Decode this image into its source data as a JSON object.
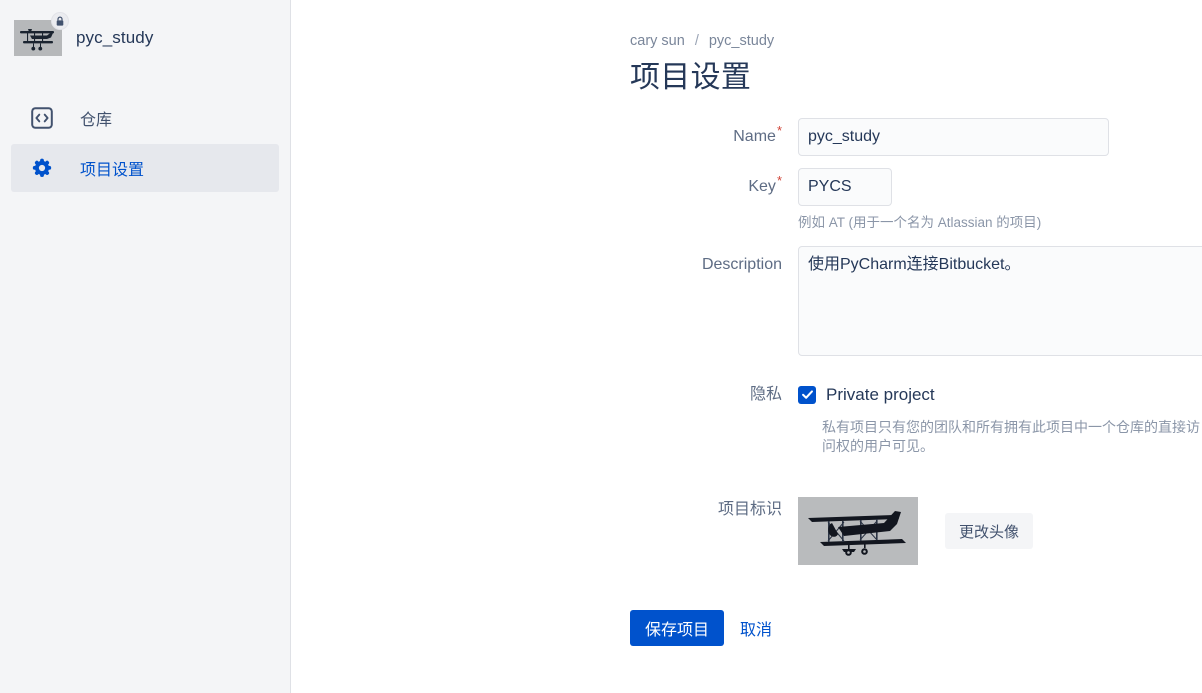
{
  "sidebar": {
    "project_name": "pyc_study",
    "logo_icon": "biplane-logo",
    "lock_badge_icon": "lock-icon",
    "items": [
      {
        "label": "仓库",
        "icon": "code-brackets-icon",
        "active": false
      },
      {
        "label": "项目设置",
        "icon": "gear-icon",
        "active": true
      }
    ]
  },
  "breadcrumb": {
    "owner": "cary sun",
    "separator": "/",
    "project": "pyc_study"
  },
  "page": {
    "title": "项目设置"
  },
  "form": {
    "name": {
      "label": "Name",
      "required_mark": "*",
      "value": "pyc_study",
      "placeholder": ""
    },
    "key": {
      "label": "Key",
      "required_mark": "*",
      "value": "PYCS",
      "placeholder": "",
      "hint": "例如 AT (用于一个名为 Atlassian 的项目)"
    },
    "description": {
      "label": "Description",
      "value": "使用PyCharm连接Bitbucket。",
      "placeholder": ""
    },
    "privacy": {
      "label": "隐私",
      "checkbox_label": "Private project",
      "checked": true,
      "hint": "私有项目只有您的团队和所有拥有此项目中一个仓库的直接访问权的用户可见。"
    },
    "logo": {
      "label": "项目标识",
      "image_icon": "biplane-avatar",
      "change_button": "更改头像"
    }
  },
  "actions": {
    "save_label": "保存项目",
    "cancel_label": "取消"
  },
  "colors": {
    "accent": "#0052cc",
    "sidebar_bg": "#f4f5f7",
    "active_item_bg": "#e6e8ed",
    "text_dark": "#253858",
    "text_muted": "#5e6c84",
    "hint": "#8b96a8",
    "required": "#d04437",
    "border": "#dfe1e6",
    "input_bg": "#fafbfc"
  }
}
